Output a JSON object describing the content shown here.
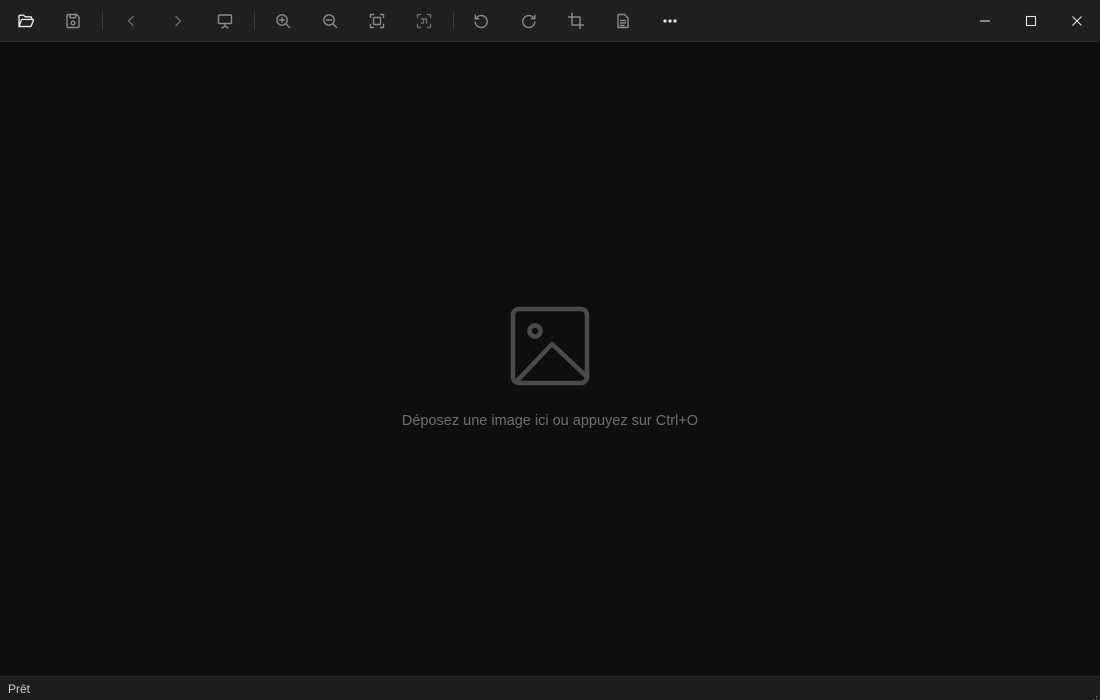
{
  "toolbar": {
    "buttons": [
      {
        "id": "open",
        "icon": "folder-open-icon",
        "tooltip": "Ouvrir"
      },
      {
        "id": "save",
        "icon": "save-icon",
        "tooltip": "Enregistrer"
      },
      {
        "id": "previous",
        "icon": "chevron-left-icon",
        "tooltip": "Précédent"
      },
      {
        "id": "next",
        "icon": "chevron-right-icon",
        "tooltip": "Suivant"
      },
      {
        "id": "slideshow",
        "icon": "slideshow-icon",
        "tooltip": "Diaporama"
      },
      {
        "id": "zoom-in",
        "icon": "zoom-in-icon",
        "tooltip": "Zoom avant"
      },
      {
        "id": "zoom-out",
        "icon": "zoom-out-icon",
        "tooltip": "Zoom arrière"
      },
      {
        "id": "fit",
        "icon": "fit-to-window-icon",
        "tooltip": "Ajuster"
      },
      {
        "id": "actual-size",
        "icon": "actual-size-icon",
        "tooltip": "Taille réelle"
      },
      {
        "id": "rotate-left",
        "icon": "rotate-left-icon",
        "tooltip": "Rotation gauche"
      },
      {
        "id": "rotate-right",
        "icon": "rotate-right-icon",
        "tooltip": "Rotation droite"
      },
      {
        "id": "crop",
        "icon": "crop-icon",
        "tooltip": "Rogner"
      },
      {
        "id": "info",
        "icon": "document-info-icon",
        "tooltip": "Informations"
      },
      {
        "id": "more",
        "icon": "more-horizontal-icon",
        "tooltip": "Plus"
      }
    ]
  },
  "window_controls": {
    "minimize": "minimize-icon",
    "maximize": "maximize-icon",
    "close": "close-icon"
  },
  "viewer": {
    "placeholder_icon": "image-placeholder-icon",
    "drop_hint": "Déposez une image ici ou appuyez sur Ctrl+O"
  },
  "status": {
    "text": "Prêt"
  },
  "colors": {
    "titlebar_bg": "#1f1f1f",
    "canvas_bg": "#0e0e0e",
    "statusbar_bg": "#1c1c1c",
    "hint_text": "#6e6e6e",
    "icon_active": "#e6e6e6",
    "icon_muted": "#8a8a8a"
  }
}
